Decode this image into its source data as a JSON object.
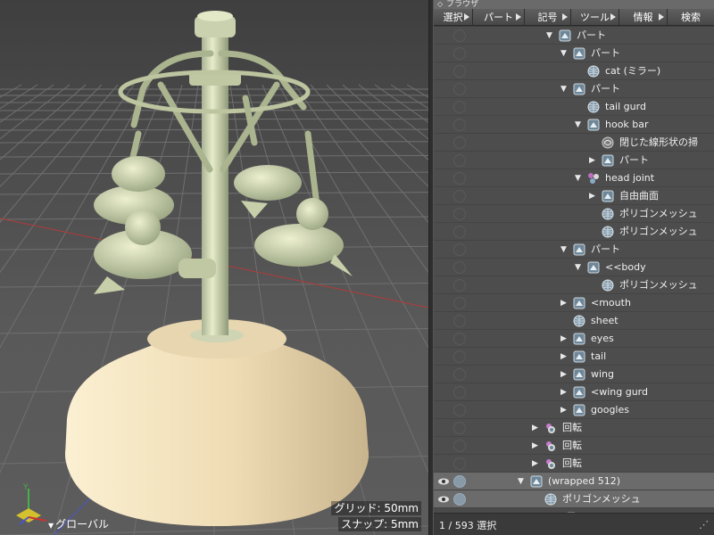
{
  "viewport": {
    "grid_readout": "グリッド: 50mm",
    "snap_readout": "スナップ: 5mm",
    "coord_system": "グローバル",
    "colors": {
      "model": "#dfe2bf",
      "base": "#f0e2bd",
      "grid": "#6e6e6e",
      "x_axis": "#c23a3a",
      "z_axis": "#4b56c8"
    }
  },
  "panel": {
    "title": "ブラウザ",
    "menu": [
      {
        "label": "選択"
      },
      {
        "label": "パート"
      },
      {
        "label": "記号"
      },
      {
        "label": "ツール"
      },
      {
        "label": "情報"
      },
      {
        "label": "検索"
      }
    ],
    "rows": [
      {
        "label": "パート",
        "indent": 0,
        "icon": "part-icon",
        "expanded": true
      },
      {
        "label": "パート",
        "indent": 1,
        "icon": "part-icon",
        "expanded": true
      },
      {
        "label": "cat (ミラー)",
        "indent": 2,
        "icon": "mesh-icon"
      },
      {
        "label": "パート",
        "indent": 1,
        "icon": "part-icon",
        "expanded": true
      },
      {
        "label": "tail gurd",
        "indent": 2,
        "icon": "mesh-icon"
      },
      {
        "label": "hook bar",
        "indent": 2,
        "icon": "part-icon",
        "expanded": true
      },
      {
        "label": "閉じた線形状の掃",
        "indent": 3,
        "icon": "sweep-icon"
      },
      {
        "label": "パート",
        "indent": 3,
        "icon": "part-icon",
        "expanded": false
      },
      {
        "label": "head joint",
        "indent": 2,
        "icon": "joint-icon",
        "expanded": true
      },
      {
        "label": "自由曲面",
        "indent": 3,
        "icon": "part-icon",
        "expanded": false
      },
      {
        "label": "ポリゴンメッシュ",
        "indent": 3,
        "icon": "mesh-icon"
      },
      {
        "label": "ポリゴンメッシュ",
        "indent": 3,
        "icon": "mesh-icon"
      },
      {
        "label": "パート",
        "indent": 1,
        "icon": "part-icon",
        "expanded": true
      },
      {
        "label": "<<body",
        "indent": 2,
        "icon": "part-icon",
        "expanded": true
      },
      {
        "label": "ポリゴンメッシュ",
        "indent": 3,
        "icon": "mesh-icon"
      },
      {
        "label": "<mouth",
        "indent": 1,
        "icon": "part-icon",
        "expanded": false
      },
      {
        "label": "sheet",
        "indent": 1,
        "icon": "mesh-icon"
      },
      {
        "label": "eyes",
        "indent": 1,
        "icon": "part-icon",
        "expanded": false
      },
      {
        "label": "tail",
        "indent": 1,
        "icon": "part-icon",
        "expanded": false
      },
      {
        "label": "wing",
        "indent": 1,
        "icon": "part-icon",
        "expanded": false
      },
      {
        "label": "<wing gurd",
        "indent": 1,
        "icon": "part-icon",
        "expanded": false
      },
      {
        "label": "googles",
        "indent": 1,
        "icon": "part-icon",
        "expanded": false
      },
      {
        "label": "回転",
        "indent": -1,
        "icon": "rotate-icon",
        "expanded": false
      },
      {
        "label": "回転",
        "indent": -1,
        "icon": "rotate-icon",
        "expanded": false
      },
      {
        "label": "回転",
        "indent": -1,
        "icon": "rotate-icon",
        "expanded": false
      },
      {
        "label": "(wrapped 512)",
        "indent": -2,
        "icon": "part-icon",
        "expanded": true,
        "selected": true
      },
      {
        "label": "ポリゴンメッシュ",
        "indent": -1,
        "icon": "mesh-icon",
        "selected": true
      }
    ],
    "status": "1 / 593 選択"
  }
}
